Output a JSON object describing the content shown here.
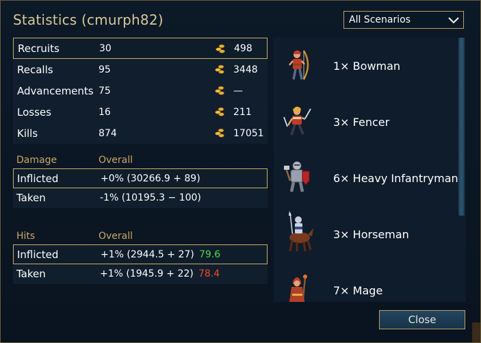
{
  "dialog": {
    "title": "Statistics (cmurph82)",
    "scenario_select": {
      "value": "All Scenarios"
    },
    "close_label": "Close"
  },
  "stats": [
    {
      "label": "Recruits",
      "count": "30",
      "gold": "498"
    },
    {
      "label": "Recalls",
      "count": "95",
      "gold": "3448"
    },
    {
      "label": "Advancements",
      "count": "75",
      "gold": "—"
    },
    {
      "label": "Losses",
      "count": "16",
      "gold": "211"
    },
    {
      "label": "Kills",
      "count": "874",
      "gold": "17051"
    }
  ],
  "damage": {
    "header": "Damage",
    "overall_header": "Overall",
    "rows": [
      {
        "label": "Inflicted",
        "value": "+0% (30266.9 + 89)"
      },
      {
        "label": "Taken",
        "value": "-1% (10195.3 − 100)"
      }
    ]
  },
  "hits": {
    "header": "Hits",
    "overall_header": "Overall",
    "rows": [
      {
        "label": "Inflicted",
        "value": "+1% (2944.5 + 27)",
        "percent": "79.6",
        "percent_color": "#4fd84a"
      },
      {
        "label": "Taken",
        "value": "+1% (1945.9 + 22)",
        "percent": "78.4",
        "percent_color": "#f04a2a"
      }
    ]
  },
  "units": [
    {
      "name": "1× Bowman",
      "icon": "bowman-icon"
    },
    {
      "name": "3× Fencer",
      "icon": "fencer-icon"
    },
    {
      "name": "6× Heavy Infantryman",
      "icon": "heavy-infantryman-icon"
    },
    {
      "name": "3× Horseman",
      "icon": "horseman-icon"
    },
    {
      "name": "7× Mage",
      "icon": "mage-icon"
    }
  ],
  "colors": {
    "title": "#d8c89a",
    "section_header": "#c9a866",
    "border_gold": "#c9b06a",
    "gold_icon": "#e8b23a"
  }
}
